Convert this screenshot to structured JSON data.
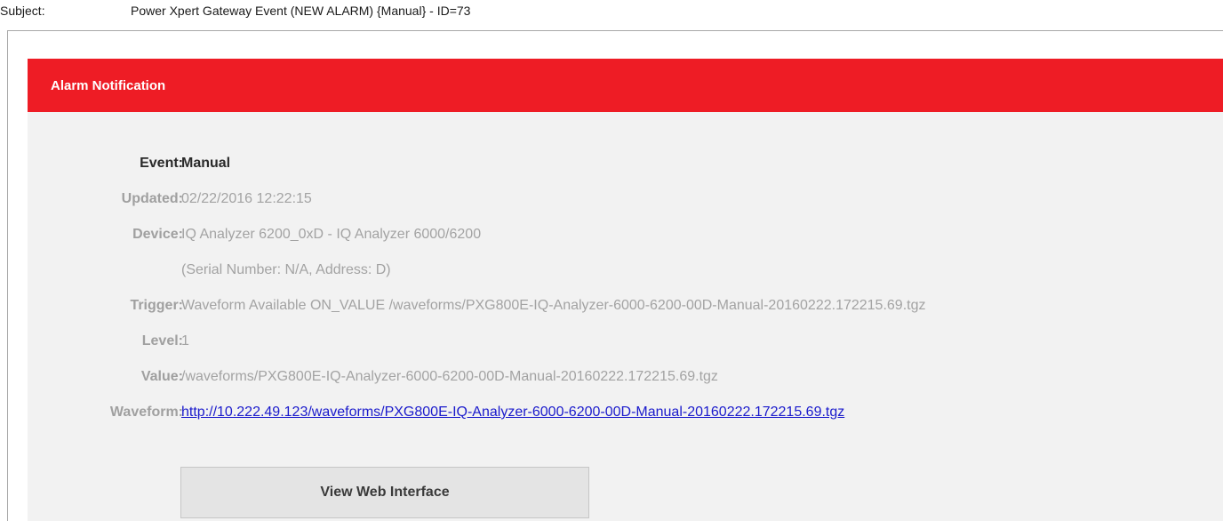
{
  "subject": {
    "label": "Subject:",
    "value": "Power Xpert Gateway Event (NEW ALARM) {Manual} - ID=73"
  },
  "notification": {
    "header": "Alarm Notification",
    "fields": {
      "event": {
        "label": "Event:",
        "value": "Manual"
      },
      "updated": {
        "label": "Updated:",
        "value": "02/22/2016 12:22:15"
      },
      "device": {
        "label": "Device:",
        "value": "IQ Analyzer 6200_0xD - IQ Analyzer 6000/6200",
        "detail": "(Serial Number: N/A, Address: D)"
      },
      "trigger": {
        "label": "Trigger:",
        "value": "Waveform Available ON_VALUE /waveforms/PXG800E-IQ-Analyzer-6000-6200-00D-Manual-20160222.172215.69.tgz"
      },
      "level": {
        "label": "Level:",
        "value": "1"
      },
      "value": {
        "label": "Value:",
        "value": "/waveforms/PXG800E-IQ-Analyzer-6000-6200-00D-Manual-20160222.172215.69.tgz"
      },
      "waveform": {
        "label": "Waveform:",
        "value": "http://10.222.49.123/waveforms/PXG800E-IQ-Analyzer-6000-6200-00D-Manual-20160222.172215.69.tgz"
      }
    },
    "button_label": "View Web Interface"
  },
  "colors": {
    "header_red": "#ee1c25",
    "card_background": "#f2f2f2",
    "link_blue": "#1a1acc",
    "muted_text": "#a3a3a3"
  }
}
